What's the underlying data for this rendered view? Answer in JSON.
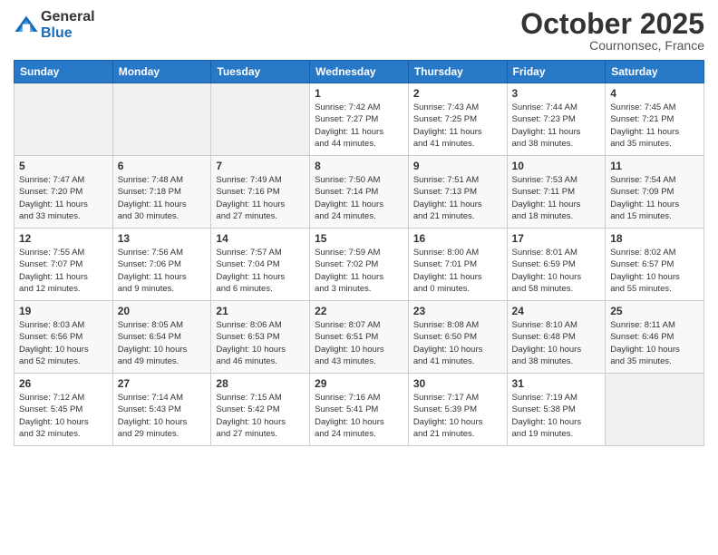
{
  "header": {
    "logo_general": "General",
    "logo_blue": "Blue",
    "month_title": "October 2025",
    "location": "Cournonsec, France"
  },
  "weekdays": [
    "Sunday",
    "Monday",
    "Tuesday",
    "Wednesday",
    "Thursday",
    "Friday",
    "Saturday"
  ],
  "weeks": [
    [
      {
        "day": "",
        "info": ""
      },
      {
        "day": "",
        "info": ""
      },
      {
        "day": "",
        "info": ""
      },
      {
        "day": "1",
        "info": "Sunrise: 7:42 AM\nSunset: 7:27 PM\nDaylight: 11 hours\nand 44 minutes."
      },
      {
        "day": "2",
        "info": "Sunrise: 7:43 AM\nSunset: 7:25 PM\nDaylight: 11 hours\nand 41 minutes."
      },
      {
        "day": "3",
        "info": "Sunrise: 7:44 AM\nSunset: 7:23 PM\nDaylight: 11 hours\nand 38 minutes."
      },
      {
        "day": "4",
        "info": "Sunrise: 7:45 AM\nSunset: 7:21 PM\nDaylight: 11 hours\nand 35 minutes."
      }
    ],
    [
      {
        "day": "5",
        "info": "Sunrise: 7:47 AM\nSunset: 7:20 PM\nDaylight: 11 hours\nand 33 minutes."
      },
      {
        "day": "6",
        "info": "Sunrise: 7:48 AM\nSunset: 7:18 PM\nDaylight: 11 hours\nand 30 minutes."
      },
      {
        "day": "7",
        "info": "Sunrise: 7:49 AM\nSunset: 7:16 PM\nDaylight: 11 hours\nand 27 minutes."
      },
      {
        "day": "8",
        "info": "Sunrise: 7:50 AM\nSunset: 7:14 PM\nDaylight: 11 hours\nand 24 minutes."
      },
      {
        "day": "9",
        "info": "Sunrise: 7:51 AM\nSunset: 7:13 PM\nDaylight: 11 hours\nand 21 minutes."
      },
      {
        "day": "10",
        "info": "Sunrise: 7:53 AM\nSunset: 7:11 PM\nDaylight: 11 hours\nand 18 minutes."
      },
      {
        "day": "11",
        "info": "Sunrise: 7:54 AM\nSunset: 7:09 PM\nDaylight: 11 hours\nand 15 minutes."
      }
    ],
    [
      {
        "day": "12",
        "info": "Sunrise: 7:55 AM\nSunset: 7:07 PM\nDaylight: 11 hours\nand 12 minutes."
      },
      {
        "day": "13",
        "info": "Sunrise: 7:56 AM\nSunset: 7:06 PM\nDaylight: 11 hours\nand 9 minutes."
      },
      {
        "day": "14",
        "info": "Sunrise: 7:57 AM\nSunset: 7:04 PM\nDaylight: 11 hours\nand 6 minutes."
      },
      {
        "day": "15",
        "info": "Sunrise: 7:59 AM\nSunset: 7:02 PM\nDaylight: 11 hours\nand 3 minutes."
      },
      {
        "day": "16",
        "info": "Sunrise: 8:00 AM\nSunset: 7:01 PM\nDaylight: 11 hours\nand 0 minutes."
      },
      {
        "day": "17",
        "info": "Sunrise: 8:01 AM\nSunset: 6:59 PM\nDaylight: 10 hours\nand 58 minutes."
      },
      {
        "day": "18",
        "info": "Sunrise: 8:02 AM\nSunset: 6:57 PM\nDaylight: 10 hours\nand 55 minutes."
      }
    ],
    [
      {
        "day": "19",
        "info": "Sunrise: 8:03 AM\nSunset: 6:56 PM\nDaylight: 10 hours\nand 52 minutes."
      },
      {
        "day": "20",
        "info": "Sunrise: 8:05 AM\nSunset: 6:54 PM\nDaylight: 10 hours\nand 49 minutes."
      },
      {
        "day": "21",
        "info": "Sunrise: 8:06 AM\nSunset: 6:53 PM\nDaylight: 10 hours\nand 46 minutes."
      },
      {
        "day": "22",
        "info": "Sunrise: 8:07 AM\nSunset: 6:51 PM\nDaylight: 10 hours\nand 43 minutes."
      },
      {
        "day": "23",
        "info": "Sunrise: 8:08 AM\nSunset: 6:50 PM\nDaylight: 10 hours\nand 41 minutes."
      },
      {
        "day": "24",
        "info": "Sunrise: 8:10 AM\nSunset: 6:48 PM\nDaylight: 10 hours\nand 38 minutes."
      },
      {
        "day": "25",
        "info": "Sunrise: 8:11 AM\nSunset: 6:46 PM\nDaylight: 10 hours\nand 35 minutes."
      }
    ],
    [
      {
        "day": "26",
        "info": "Sunrise: 7:12 AM\nSunset: 5:45 PM\nDaylight: 10 hours\nand 32 minutes."
      },
      {
        "day": "27",
        "info": "Sunrise: 7:14 AM\nSunset: 5:43 PM\nDaylight: 10 hours\nand 29 minutes."
      },
      {
        "day": "28",
        "info": "Sunrise: 7:15 AM\nSunset: 5:42 PM\nDaylight: 10 hours\nand 27 minutes."
      },
      {
        "day": "29",
        "info": "Sunrise: 7:16 AM\nSunset: 5:41 PM\nDaylight: 10 hours\nand 24 minutes."
      },
      {
        "day": "30",
        "info": "Sunrise: 7:17 AM\nSunset: 5:39 PM\nDaylight: 10 hours\nand 21 minutes."
      },
      {
        "day": "31",
        "info": "Sunrise: 7:19 AM\nSunset: 5:38 PM\nDaylight: 10 hours\nand 19 minutes."
      },
      {
        "day": "",
        "info": ""
      }
    ]
  ]
}
